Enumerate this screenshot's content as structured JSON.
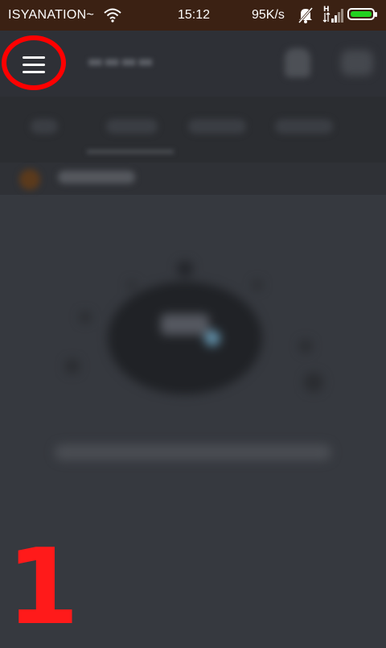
{
  "status_bar": {
    "carrier": "ISYANATION~",
    "time": "15:12",
    "network_speed": "95K/s",
    "signal_label": "H",
    "icons": [
      "wifi-icon",
      "bell-muted-icon",
      "signal-icon",
      "battery-icon"
    ],
    "battery_color": "#22d11f",
    "battery_level": 1.0
  },
  "annotation": {
    "step": "1",
    "color": "#ff0000",
    "highlight_target": "menu-button"
  },
  "colors": {
    "status_bar_bg": "#3b2113",
    "app_bg": "#36393f",
    "header_bg": "#2e3036",
    "tabs_bg": "#2b2d31"
  },
  "icons": {
    "menu": "hamburger-menu-icon"
  }
}
